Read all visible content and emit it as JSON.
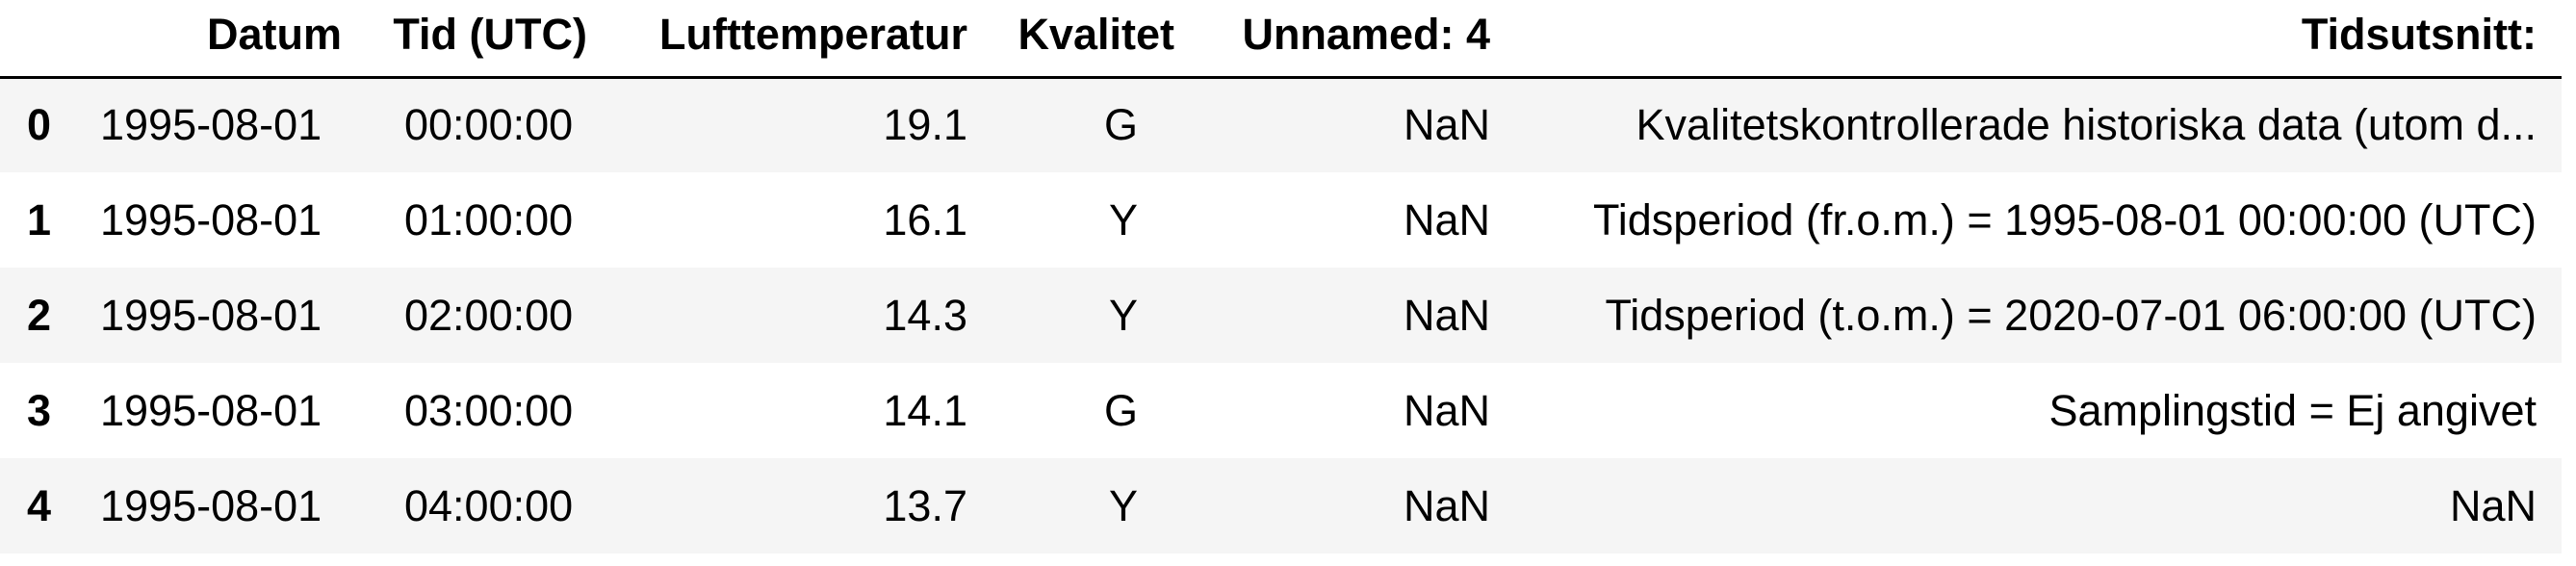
{
  "table": {
    "columns": {
      "index": "",
      "datum": "Datum",
      "tid": "Tid (UTC)",
      "lufttemperatur": "Lufttemperatur",
      "kvalitet": "Kvalitet",
      "unnamed": "Unnamed: 4",
      "tidsutsnitt": "Tidsutsnitt:"
    },
    "rows": [
      {
        "index": "0",
        "datum": "1995-08-01",
        "tid": "00:00:00",
        "lufttemperatur": "19.1",
        "kvalitet": "G",
        "unnamed": "NaN",
        "tidsutsnitt": "Kvalitetskontrollerade historiska data (utom d..."
      },
      {
        "index": "1",
        "datum": "1995-08-01",
        "tid": "01:00:00",
        "lufttemperatur": "16.1",
        "kvalitet": "Y",
        "unnamed": "NaN",
        "tidsutsnitt": "Tidsperiod (fr.o.m.) = 1995-08-01 00:00:00 (UTC)"
      },
      {
        "index": "2",
        "datum": "1995-08-01",
        "tid": "02:00:00",
        "lufttemperatur": "14.3",
        "kvalitet": "Y",
        "unnamed": "NaN",
        "tidsutsnitt": "Tidsperiod (t.o.m.) = 2020-07-01 06:00:00 (UTC)"
      },
      {
        "index": "3",
        "datum": "1995-08-01",
        "tid": "03:00:00",
        "lufttemperatur": "14.1",
        "kvalitet": "G",
        "unnamed": "NaN",
        "tidsutsnitt": "Samplingstid = Ej angivet"
      },
      {
        "index": "4",
        "datum": "1995-08-01",
        "tid": "04:00:00",
        "lufttemperatur": "13.7",
        "kvalitet": "Y",
        "unnamed": "NaN",
        "tidsutsnitt": "NaN"
      }
    ]
  },
  "colors": {
    "odd_row_background": "#f5f5f5",
    "even_row_background": "#ffffff",
    "header_border": "#000000",
    "text": "#000000"
  }
}
